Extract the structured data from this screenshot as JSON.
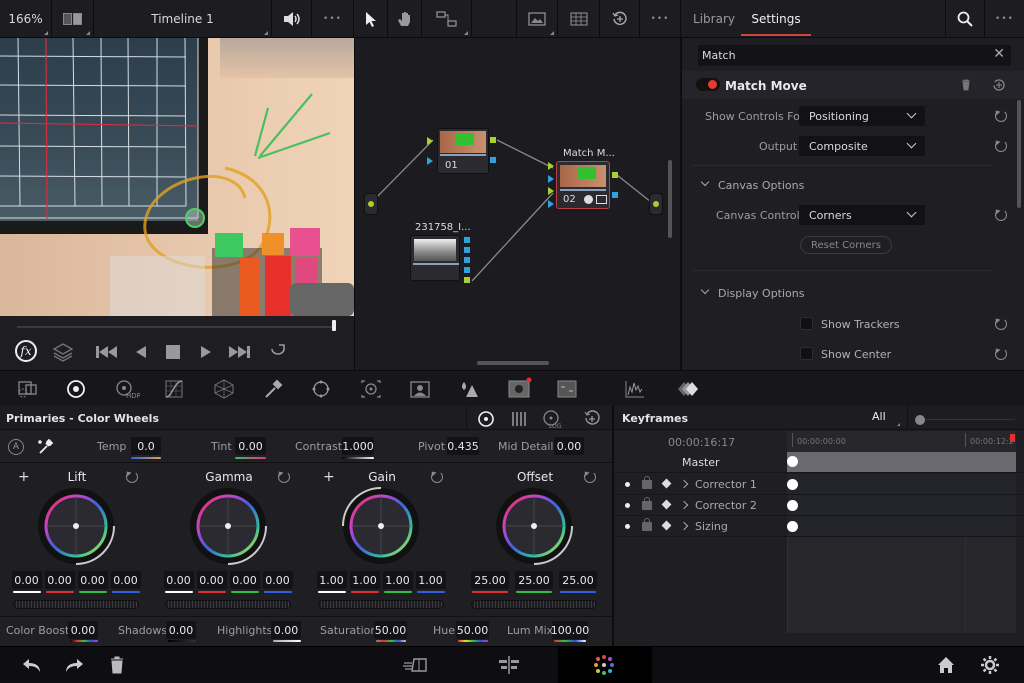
{
  "topbar": {
    "zoom": "166%",
    "timeline": "Timeline 1",
    "more_label": "•••",
    "tabs": [
      {
        "label": "Library"
      },
      {
        "label": "Settings"
      }
    ],
    "active_tab": "Settings",
    "accent": "#c8463c"
  },
  "nodes": {
    "node1_label": "01",
    "node2_title": "Match M...",
    "node2_label": "02",
    "node3_title": "231758_I..."
  },
  "settings": {
    "search_value": "Match",
    "effect_name": "Match Move",
    "effect_enabled": true,
    "show_controls_label": "Show Controls For",
    "show_controls_value": "Positioning",
    "output_label": "Output",
    "output_value": "Composite",
    "canvas_options_label": "Canvas Options",
    "canvas_controls_label": "Canvas Controls",
    "canvas_controls_value": "Corners",
    "reset_corners_label": "Reset Corners",
    "display_options_label": "Display Options",
    "show_trackers_label": "Show Trackers",
    "show_trackers_checked": false,
    "show_center_label": "Show Center",
    "show_center_checked": false
  },
  "primaries": {
    "title": "Primaries - Color Wheels",
    "temp_label": "Temp",
    "temp": "0.0",
    "tint_label": "Tint",
    "tint": "0.00",
    "contrast_label": "Contrast",
    "contrast": "1.000",
    "pivot_label": "Pivot",
    "pivot": "0.435",
    "mid_detail_label": "Mid Detail",
    "mid_detail": "0.00",
    "wheels": [
      {
        "name": "Lift",
        "values": [
          "0.00",
          "0.00",
          "0.00",
          "0.00"
        ]
      },
      {
        "name": "Gamma",
        "values": [
          "0.00",
          "0.00",
          "0.00",
          "0.00"
        ]
      },
      {
        "name": "Gain",
        "values": [
          "1.00",
          "1.00",
          "1.00",
          "1.00"
        ]
      },
      {
        "name": "Offset",
        "values": [
          "25.00",
          "25.00",
          "25.00"
        ]
      }
    ],
    "color_boost_label": "Color Boost",
    "color_boost": "0.00",
    "shadows_label": "Shadows",
    "shadows": "0.00",
    "highlights_label": "Highlights",
    "highlights": "0.00",
    "saturation_label": "Saturation",
    "saturation": "50.00",
    "hue_label": "Hue",
    "hue": "50.00",
    "lum_mix_label": "Lum Mix",
    "lum_mix": "100.00"
  },
  "keyframes": {
    "title": "Keyframes",
    "filter": "All",
    "timecode": "00:00:16:17",
    "ruler_start": "00:00:00:00",
    "ruler_end": "00:00:12:2",
    "tracks": [
      {
        "name": "Master"
      },
      {
        "name": "Corrector 1"
      },
      {
        "name": "Corrector 2"
      },
      {
        "name": "Sizing"
      }
    ]
  }
}
